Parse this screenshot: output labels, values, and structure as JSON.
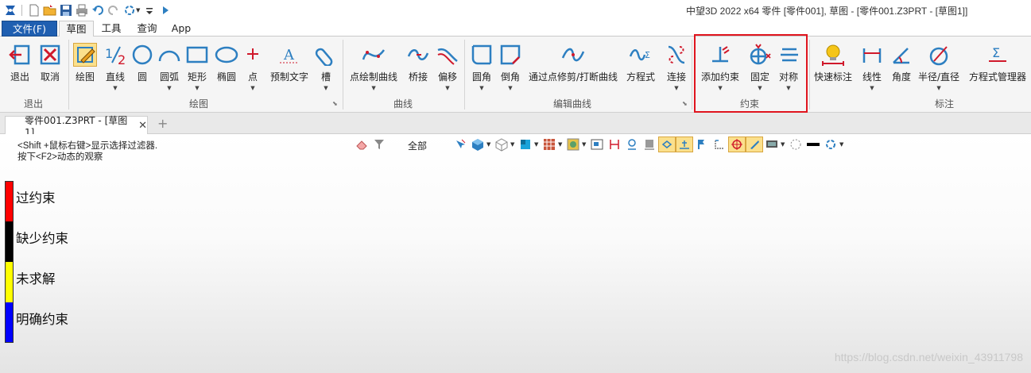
{
  "title": "中望3D 2022 x64      零件 [零件001], 草图 - [零件001.Z3PRT - [草图1]]",
  "menu": {
    "file": "文件(F)",
    "tabs": [
      "草图",
      "工具",
      "查询",
      "App"
    ]
  },
  "ribbon": {
    "groups": {
      "exit": "退出",
      "draw": "绘图",
      "curve": "曲线",
      "edit_curve": "编辑曲线",
      "constraint": "约束",
      "dimension": "标注"
    },
    "tools": {
      "exit": "退出",
      "cancel": "取消",
      "draw": "绘图",
      "line": "直线",
      "circle": "圆",
      "arc": "圆弧",
      "rect": "矩形",
      "ellipse": "椭圆",
      "point": "点",
      "preset_text": "预制文字",
      "slot": "槽",
      "point_curve": "点绘制曲线",
      "bridge": "桥接",
      "offset": "偏移",
      "fillet": "圆角",
      "chamfer": "倒角",
      "trim": "通过点修剪/打断曲线",
      "equation": "方程式",
      "connect": "连接",
      "add_constraint": "添加约束",
      "fix": "固定",
      "symmetry": "对称",
      "quick_dim": "快速标注",
      "linear": "线性",
      "angle": "角度",
      "radius": "半径/直径",
      "eq_manager": "方程式管理器"
    }
  },
  "doc_tab": {
    "label": "零件001.Z3PRT - [草图1]"
  },
  "viewport": {
    "hint_line1": "<Shift +鼠标右键>显示选择过滤器.",
    "hint_line2": "按下<F2>动态的观察",
    "filter": "全部",
    "legend": [
      {
        "label": "过约束",
        "color": "#ff0000"
      },
      {
        "label": "缺少约束",
        "color": "#000000"
      },
      {
        "label": "未求解",
        "color": "#ffff00"
      },
      {
        "label": "明确约束",
        "color": "#0000ff"
      }
    ],
    "watermark": "https://blog.csdn.net/weixin_43911798"
  },
  "colors": {
    "accent": "#1f5fb1",
    "highlight": "#e0141e",
    "icon_blue": "#2d7fc1",
    "icon_red": "#d0192b"
  }
}
